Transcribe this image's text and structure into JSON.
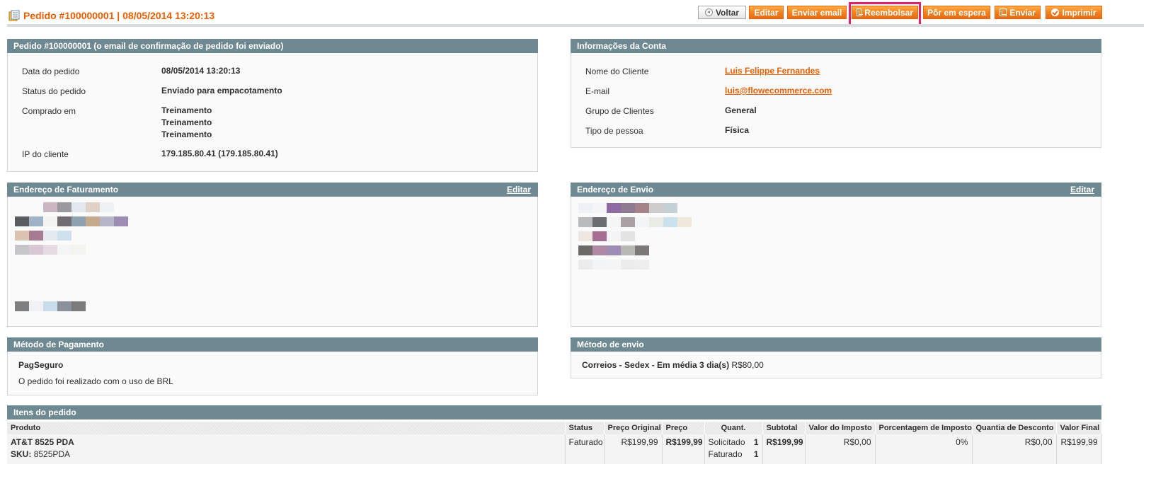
{
  "header": {
    "title": "Pedido #100000001 | 08/05/2014 13:20:13",
    "buttons": [
      {
        "label": "Voltar"
      },
      {
        "label": "Editar"
      },
      {
        "label": "Enviar email"
      },
      {
        "label": "Reembolsar"
      },
      {
        "label": "Pôr em espera"
      },
      {
        "label": "Enviar"
      },
      {
        "label": "Imprimir"
      }
    ]
  },
  "order_box": {
    "title": "Pedido #100000001 (o email de confirmação de pedido foi enviado)",
    "rows": [
      {
        "label": "Data do pedido",
        "value": "08/05/2014 13:20:13"
      },
      {
        "label": "Status do pedido",
        "value": "Enviado para empacotamento"
      },
      {
        "label": "Comprado em",
        "values": [
          "Treinamento",
          "Treinamento",
          "Treinamento"
        ]
      },
      {
        "label": "IP do cliente",
        "value": "179.185.80.41 (179.185.80.41)"
      }
    ]
  },
  "account_box": {
    "title": "Informações da Conta",
    "rows": [
      {
        "label": "Nome do Cliente",
        "value": "Luis Felippe Fernandes"
      },
      {
        "label": "E-mail",
        "value": "luis@flowecommerce.com"
      },
      {
        "label": "Grupo de Clientes",
        "value": "General"
      },
      {
        "label": "Tipo de pessoa",
        "value": "Física"
      }
    ]
  },
  "billing_box": {
    "title": "Endereço de Faturamento",
    "edit_label": "Editar"
  },
  "shipping_box": {
    "title": "Endereço de Envio",
    "edit_label": "Editar"
  },
  "payment_box": {
    "title": "Método de Pagamento",
    "method": "PagSeguro",
    "note": "O pedido foi realizado com o uso de BRL"
  },
  "shipping_method_box": {
    "title": "Método de envio",
    "method": "Correios - Sedex - Em média 3 dia(s)",
    "price": "R$80,00"
  },
  "items": {
    "title": "Itens do pedido",
    "columns": [
      "Produto",
      "Status",
      "Preço Original",
      "Preço",
      "Quant.",
      "Subtotal",
      "Valor do Imposto",
      "Porcentagem de Imposto",
      "Quantia de Desconto",
      "Valor Final"
    ],
    "rows": [
      {
        "product": "AT&T 8525 PDA",
        "sku_label": "SKU:",
        "sku": "8525PDA",
        "status": "Faturado",
        "original_price": "R$199,99",
        "price": "R$199,99",
        "qty_ordered_label": "Solicitado",
        "qty_ordered": "1",
        "qty_invoiced_label": "Faturado",
        "qty_invoiced": "1",
        "subtotal": "R$199,99",
        "tax_amount": "R$0,00",
        "tax_percent": "0%",
        "discount": "R$0,00",
        "row_total": "R$199,99"
      }
    ]
  },
  "colors": {
    "accent": "#eb5e00",
    "button": "#f2801f",
    "box_header": "#6f8992",
    "highlight": "#e2226e"
  }
}
